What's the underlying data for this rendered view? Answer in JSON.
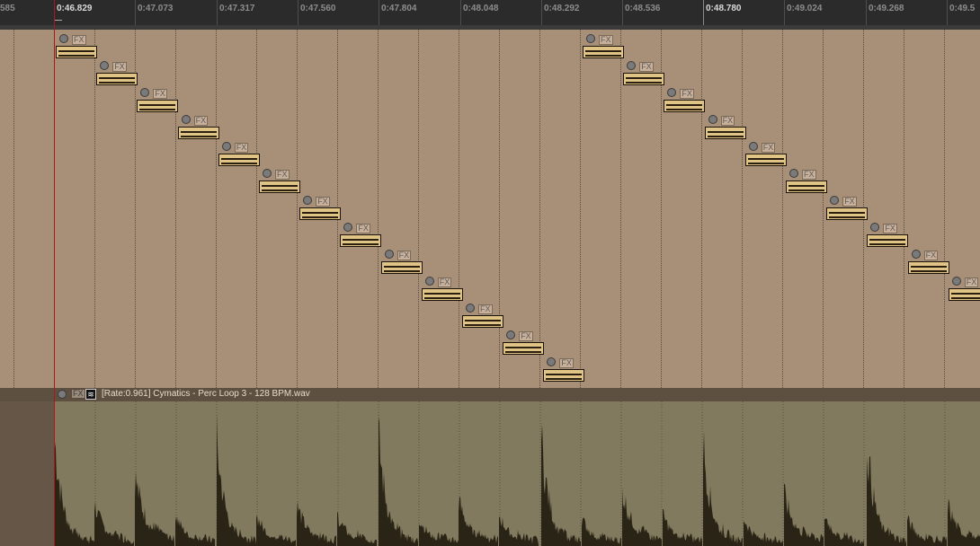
{
  "ruler": {
    "labels": [
      "585",
      "0:46.829",
      "0:47.073",
      "0:47.317",
      "0:47.560",
      "0:47.804",
      "0:48.048",
      "0:48.292",
      "0:48.536",
      "0:48.780",
      "0:49.024",
      "0:49.268",
      "0:49.5"
    ],
    "major_labels": [
      "0:46.829",
      "0:48.780"
    ]
  },
  "midi_items": {
    "fx_label": "FX",
    "count": 23
  },
  "audio_item": {
    "fx_label": "FX",
    "env_icon": "envelope-icon",
    "label": "[Rate:0.961] Cymatics - Perc Loop 3 - 128 BPM.wav"
  },
  "colors": {
    "arrange_bg": "#a89078",
    "item_fill": "#e0c486",
    "audio_bg": "#827a5e",
    "waveform": "#2a2416",
    "playhead": "#b01818",
    "ruler_bg": "#2b2b2b"
  }
}
